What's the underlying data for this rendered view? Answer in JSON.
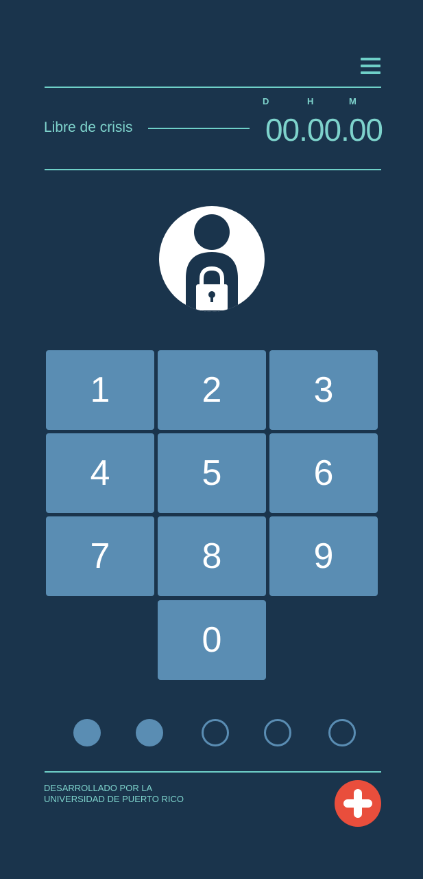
{
  "header": {
    "menu_icon": "hamburger-menu-icon",
    "timer_units": {
      "d": "D",
      "h": "H",
      "m": "M"
    },
    "crisis_label": "Libre de crisis",
    "timer_value": "00.00.00"
  },
  "lock": {
    "icon": "user-lock-icon"
  },
  "keypad": {
    "keys": [
      "1",
      "2",
      "3",
      "4",
      "5",
      "6",
      "7",
      "8",
      "9",
      "0"
    ]
  },
  "pin": {
    "length": 5,
    "filled": 2
  },
  "footer": {
    "line1": "DESARROLLADO POR LA",
    "line2": "UNIVERSIDAD DE PUERTO RICO",
    "emergency_icon": "medical-cross-icon"
  },
  "colors": {
    "background": "#1a344c",
    "accent": "#6fd0c8",
    "key": "#5a8db3",
    "emergency": "#e94e3c"
  }
}
